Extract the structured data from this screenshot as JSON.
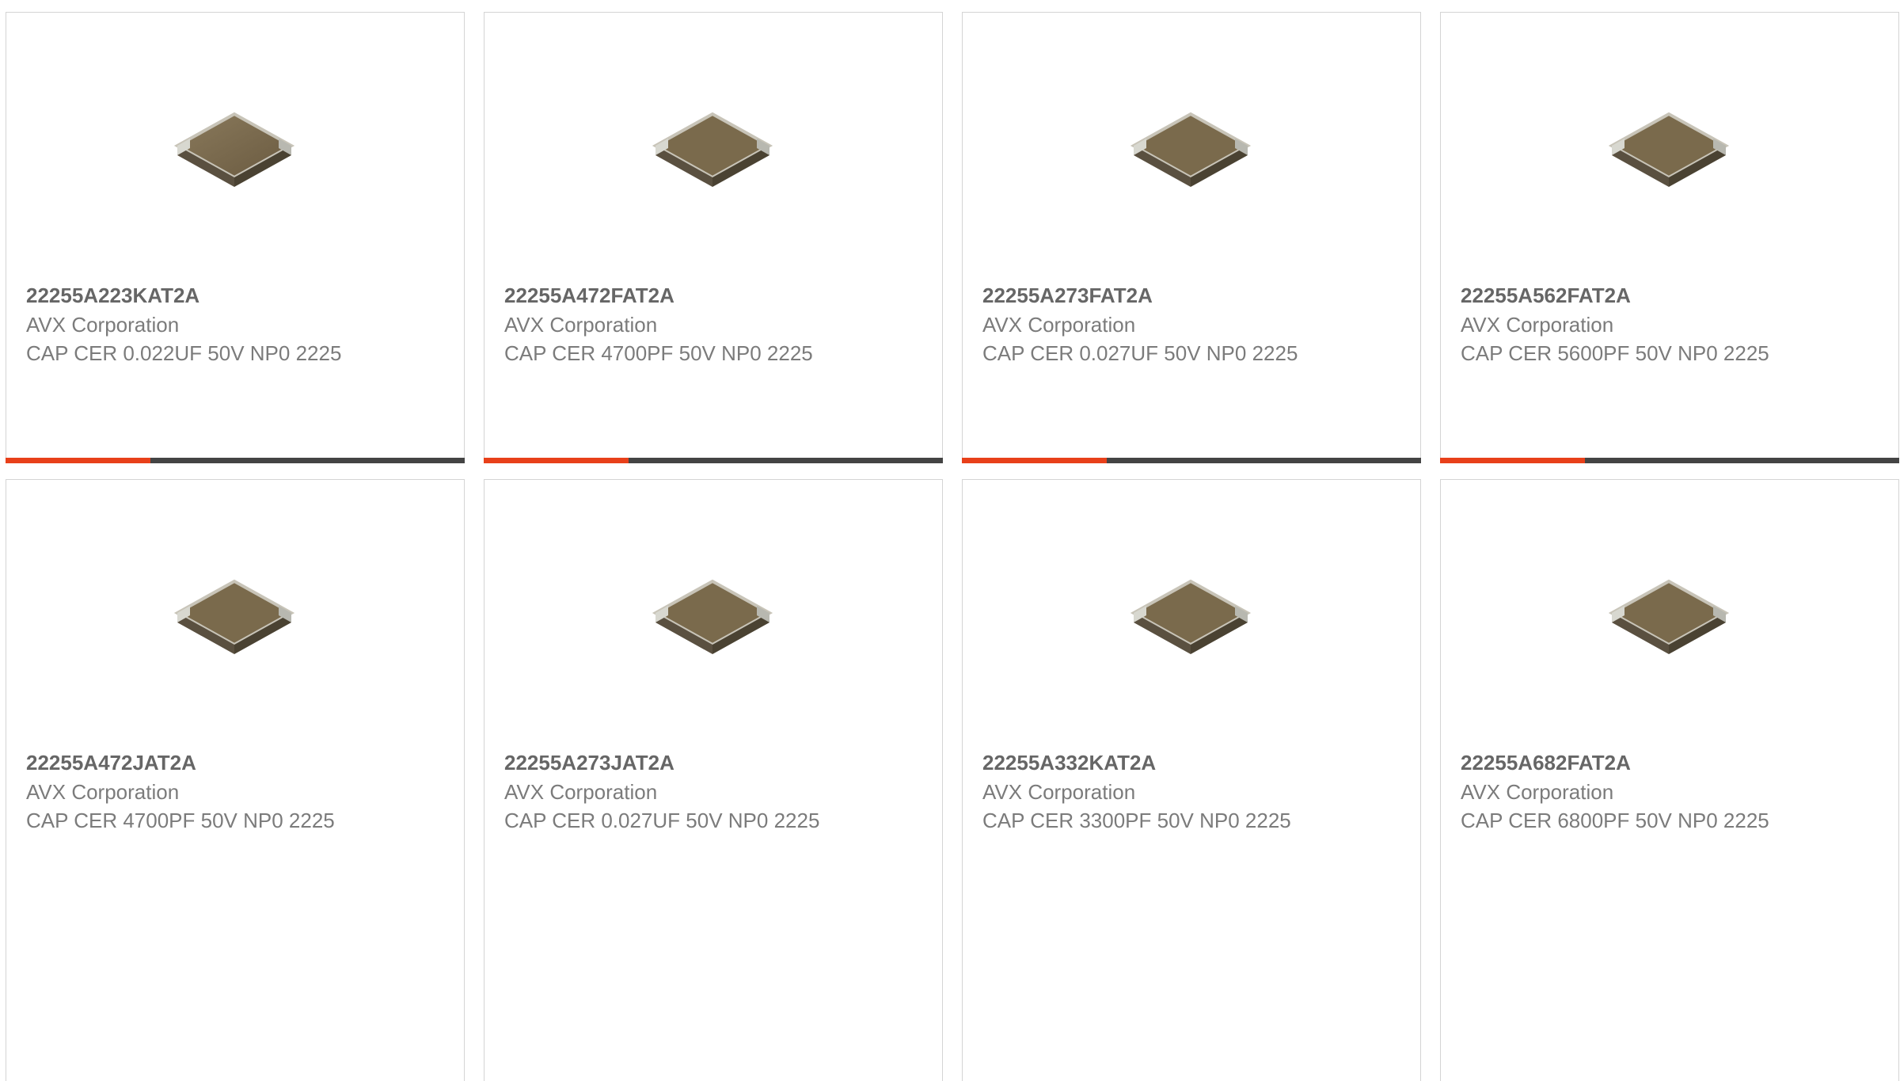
{
  "colors": {
    "accent": "#e8401a",
    "bar_dark": "#444444",
    "card_border": "#d4d4d4",
    "text": "#7b7b7b"
  },
  "products": [
    {
      "part": "22255A223KAT2A",
      "manufacturer": "AVX Corporation",
      "description": "CAP CER 0.022UF 50V NP0 2225",
      "image_icon": "ceramic-capacitor-chip-icon"
    },
    {
      "part": "22255A472FAT2A",
      "manufacturer": "AVX Corporation",
      "description": "CAP CER 4700PF 50V NP0 2225",
      "image_icon": "ceramic-capacitor-chip-icon"
    },
    {
      "part": "22255A273FAT2A",
      "manufacturer": "AVX Corporation",
      "description": "CAP CER 0.027UF 50V NP0 2225",
      "image_icon": "ceramic-capacitor-chip-icon"
    },
    {
      "part": "22255A562FAT2A",
      "manufacturer": "AVX Corporation",
      "description": "CAP CER 5600PF 50V NP0 2225",
      "image_icon": "ceramic-capacitor-chip-icon"
    },
    {
      "part": "22255A472JAT2A",
      "manufacturer": "AVX Corporation",
      "description": "CAP CER 4700PF 50V NP0 2225",
      "image_icon": "ceramic-capacitor-chip-icon"
    },
    {
      "part": "22255A273JAT2A",
      "manufacturer": "AVX Corporation",
      "description": "CAP CER 0.027UF 50V NP0 2225",
      "image_icon": "ceramic-capacitor-chip-icon"
    },
    {
      "part": "22255A332KAT2A",
      "manufacturer": "AVX Corporation",
      "description": "CAP CER 3300PF 50V NP0 2225",
      "image_icon": "ceramic-capacitor-chip-icon"
    },
    {
      "part": "22255A682FAT2A",
      "manufacturer": "AVX Corporation",
      "description": "CAP CER 6800PF 50V NP0 2225",
      "image_icon": "ceramic-capacitor-chip-icon"
    }
  ]
}
